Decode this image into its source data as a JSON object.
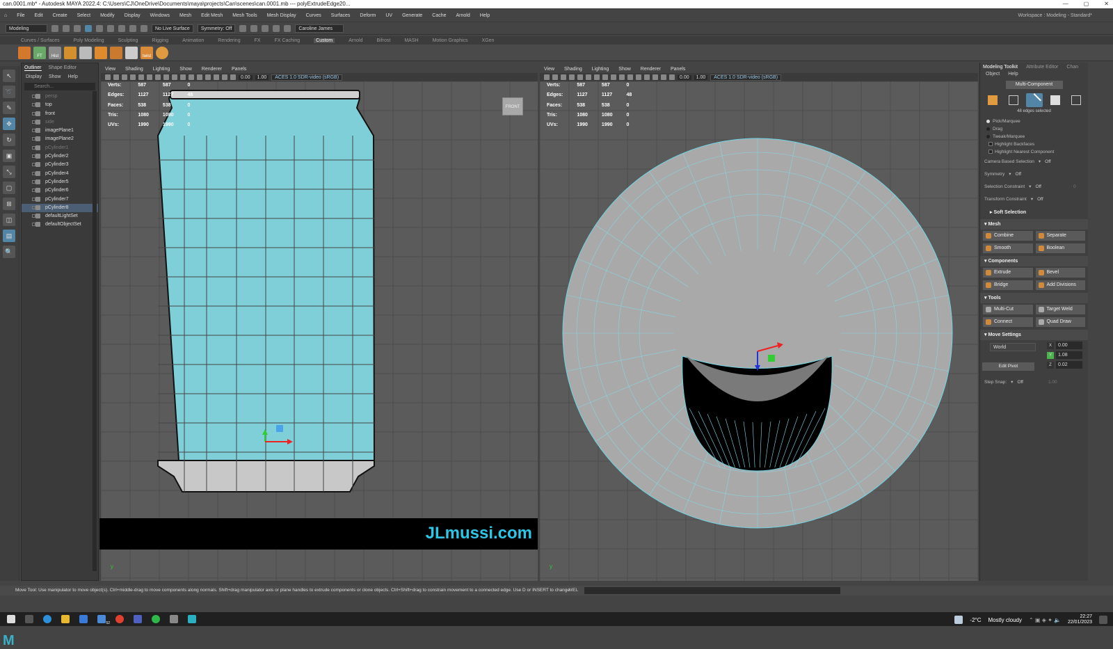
{
  "title": "can.0001.mb* - Autodesk MAYA 2022.4: C:\\Users\\CJ\\OneDrive\\Documents\\maya\\projects\\Can\\scenes\\can.0001.mb  ---  polyExtrudeEdge20...",
  "menus": [
    "File",
    "Edit",
    "Create",
    "Select",
    "Modify",
    "Display",
    "Windows",
    "Mesh",
    "Edit Mesh",
    "Mesh Tools",
    "Mesh Display",
    "Curves",
    "Surfaces",
    "Deform",
    "UV",
    "Generate",
    "Cache",
    "Arnold",
    "Help"
  ],
  "workspace": "Workspace : Modeling - Standard*",
  "status": {
    "mode": "Modeling",
    "live": "No Live Surface",
    "symmetry": "Symmetry: Off",
    "user": "Caroline James"
  },
  "shelf_tabs": [
    "Curves / Surfaces",
    "Poly Modeling",
    "Sculpting",
    "Rigging",
    "Animation",
    "Rendering",
    "FX",
    "FX Caching",
    "Custom",
    "Arnold",
    "Bifrost",
    "MASH",
    "Motion Graphics",
    "XGen"
  ],
  "shelf_active": "Custom",
  "shelf_labels": {
    "ft": "FT",
    "hist": "Hist",
    "twist": "twist"
  },
  "outliner": {
    "tabs": [
      "Outliner",
      "Shape Editor"
    ],
    "menus": [
      "Display",
      "Show",
      "Help"
    ],
    "search_placeholder": "Search...",
    "items": [
      {
        "label": "persp",
        "dim": true
      },
      {
        "label": "top",
        "dim": false
      },
      {
        "label": "front",
        "dim": false
      },
      {
        "label": "side",
        "dim": true
      },
      {
        "label": "imagePlane1",
        "dim": false
      },
      {
        "label": "imagePlane2",
        "dim": false
      },
      {
        "label": "pCylinder1",
        "dim": true
      },
      {
        "label": "pCylinder2",
        "dim": false
      },
      {
        "label": "pCylinder3",
        "dim": false
      },
      {
        "label": "pCylinder4",
        "dim": false
      },
      {
        "label": "pCylinder5",
        "dim": false
      },
      {
        "label": "pCylinder6",
        "dim": false
      },
      {
        "label": "pCylinder7",
        "dim": false
      },
      {
        "label": "pCylinder8",
        "dim": false,
        "selected": true
      },
      {
        "label": "defaultLightSet",
        "dim": false
      },
      {
        "label": "defaultObjectSet",
        "dim": false
      }
    ]
  },
  "viewport_menus": [
    "View",
    "Shading",
    "Lighting",
    "Show",
    "Renderer",
    "Panels"
  ],
  "viewport_toolbar": {
    "n1": "0.00",
    "n2": "1.00",
    "color": "ACES 1.0 SDR-video (sRGB)"
  },
  "hud_left": {
    "rows": [
      [
        "Verts:",
        "587",
        "587",
        "0"
      ],
      [
        "Edges:",
        "1127",
        "1127",
        "48"
      ],
      [
        "Faces:",
        "538",
        "538",
        "0"
      ],
      [
        "Tris:",
        "1080",
        "1080",
        "0"
      ],
      [
        "UVs:",
        "1990",
        "1990",
        "0"
      ]
    ]
  },
  "hud_right": {
    "rows": [
      [
        "Verts:",
        "587",
        "587",
        "0"
      ],
      [
        "Edges:",
        "1127",
        "1127",
        "48"
      ],
      [
        "Faces:",
        "538",
        "538",
        "0"
      ],
      [
        "Tris:",
        "1080",
        "1080",
        "0"
      ],
      [
        "UVs:",
        "1990",
        "1990",
        "0"
      ]
    ]
  },
  "front_label": "FRONT",
  "watermark": "JLmussi.com",
  "right_panel": {
    "tabs": [
      "Modeling Toolkit",
      "Attribute Editor",
      "Chan"
    ],
    "menus": [
      "Object",
      "Help"
    ],
    "multi_component": "Multi-Component",
    "edges_selected": "48 edges selected",
    "options": [
      "Pick/Marquee",
      "Drag",
      "Tweak/Marquee"
    ],
    "checks": [
      "Highlight Backfaces",
      "Highlight Nearest Component"
    ],
    "camera_sel": {
      "label": "Camera Based Selection",
      "value": "Off"
    },
    "symmetry": {
      "label": "Symmetry",
      "value": "Off"
    },
    "sel_constraint": {
      "label": "Selection Constraint",
      "value": "Off",
      "num": "0"
    },
    "transform_constraint": {
      "label": "Transform Constraint",
      "value": "Off"
    },
    "soft_selection": "Soft Selection",
    "mesh": {
      "title": "Mesh",
      "buttons": [
        "Combine",
        "Separate",
        "Smooth",
        "Boolean"
      ]
    },
    "components": {
      "title": "Components",
      "buttons": [
        "Extrude",
        "Bevel",
        "Bridge",
        "Add Divisions"
      ]
    },
    "tools": {
      "title": "Tools",
      "buttons": [
        "Multi-Cut",
        "Target Weld",
        "Connect",
        "Quad Draw"
      ]
    },
    "move_settings": {
      "title": "Move Settings",
      "space": "World",
      "x": "0.00",
      "y": "1.08",
      "z": "0.02",
      "edit_pivot": "Edit Pivot",
      "step_snap": "Step Snap:",
      "step_val": "Off",
      "step_num": "1.00"
    }
  },
  "helpline": "Move Tool: Use manipulator to move object(s). Ctrl+middle-drag to move components along normals. Shift+drag manipulator axis or plane handles to extrude components or clone objects. Ctrl+Shift+drag to constrain movement to a connected edge. Use D or INSERT to change",
  "mel": "MEL",
  "taskbar": {
    "weather_temp": "-2°C",
    "weather_text": "Mostly cloudy",
    "time": "22:27",
    "date": "22/01/2023",
    "badge": "52"
  },
  "colors": {
    "accent": "#5285a6",
    "watermark": "#2ec6e6",
    "can_fill": "#7ecfd8",
    "wire": "#7fe0f0"
  }
}
